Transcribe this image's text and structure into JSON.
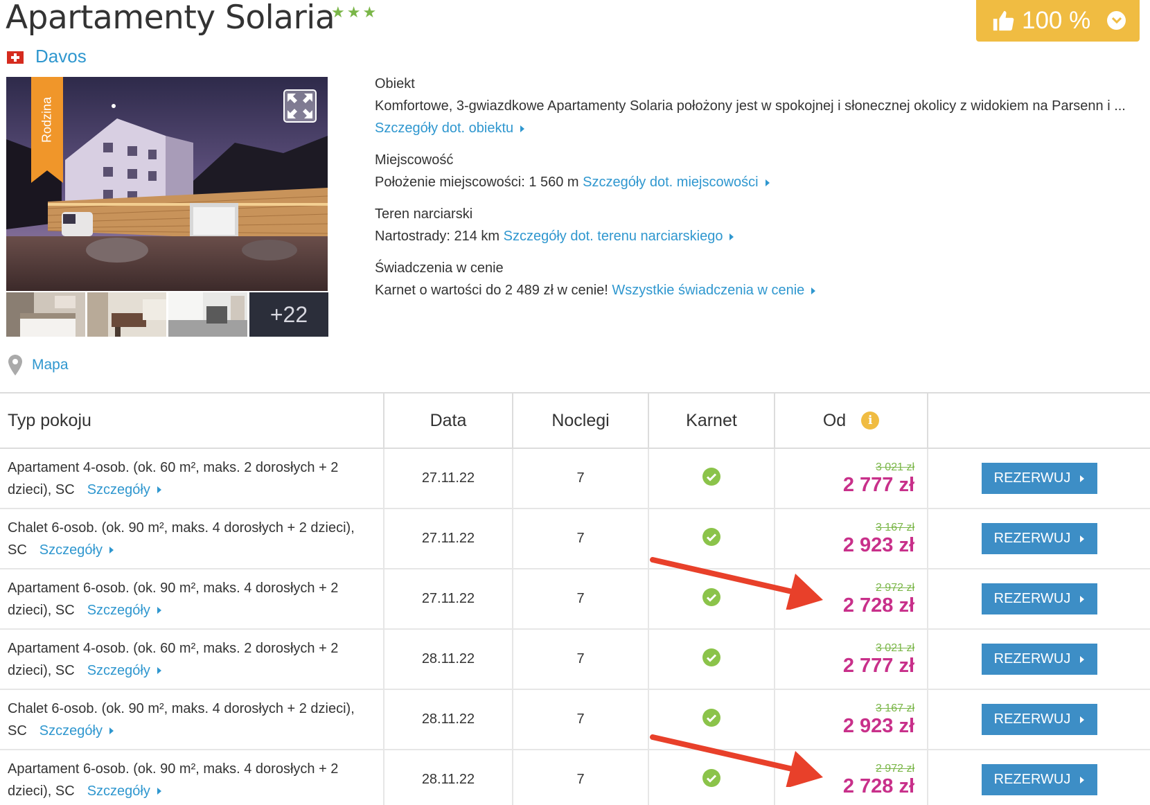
{
  "hotel": {
    "name": "Apartamenty Solaria",
    "stars": "★★★",
    "city": "Davos"
  },
  "rating": {
    "value": "100 %",
    "color": "#f0bc42"
  },
  "gallery": {
    "badge": "Rodzina",
    "more_label": "+22"
  },
  "map": {
    "label": "Mapa"
  },
  "info": {
    "object": {
      "heading": "Obiekt",
      "text": "Komfortowe, 3-gwiazdkowe Apartamenty Solaria położony jest w spokojnej i słonecznej okolicy z widokiem na Parsenn i ...",
      "link": "Szczegóły dot. obiektu"
    },
    "town": {
      "heading": "Miejscowość",
      "text": "Położenie miejscowości: 1 560 m",
      "link": "Szczegóły dot. miejscowości"
    },
    "ski": {
      "heading": "Teren narciarski",
      "text": "Nartostrady: 214 km",
      "link": "Szczegóły dot. terenu narciarskiego"
    },
    "benefits": {
      "heading": "Świadczenia w cenie",
      "text": "Karnet o wartości do 2 489 zł w cenie!",
      "link": "Wszystkie świadczenia w cenie"
    }
  },
  "table": {
    "headers": {
      "room": "Typ pokoju",
      "date": "Data",
      "nights": "Noclegi",
      "pass": "Karnet",
      "from": "Od"
    },
    "details_label": "Szczegóły",
    "book_label": "REZERWUJ",
    "rows": [
      {
        "room": "Apartament 4-osob. (ok. 60 m², maks. 2 dorosłych + 2 dzieci), SC",
        "date": "27.11.22",
        "nights": "7",
        "old_price": "3 021 zł",
        "price": "2 777 zł"
      },
      {
        "room": "Chalet 6-osob. (ok. 90 m², maks. 4 dorosłych + 2 dzieci), SC",
        "date": "27.11.22",
        "nights": "7",
        "old_price": "3 167 zł",
        "price": "2 923 zł"
      },
      {
        "room": "Apartament 6-osob. (ok. 90 m², maks. 4 dorosłych + 2 dzieci), SC",
        "date": "27.11.22",
        "nights": "7",
        "old_price": "2 972 zł",
        "price": "2 728 zł"
      },
      {
        "room": "Apartament 4-osob. (ok. 60 m², maks. 2 dorosłych + 2 dzieci), SC",
        "date": "28.11.22",
        "nights": "7",
        "old_price": "3 021 zł",
        "price": "2 777 zł"
      },
      {
        "room": "Chalet 6-osob. (ok. 90 m², maks. 4 dorosłych + 2 dzieci), SC",
        "date": "28.11.22",
        "nights": "7",
        "old_price": "3 167 zł",
        "price": "2 923 zł"
      },
      {
        "room": "Apartament 6-osob. (ok. 90 m², maks. 4 dorosłych + 2 dzieci), SC",
        "date": "28.11.22",
        "nights": "7",
        "old_price": "2 972 zł",
        "price": "2 728 zł"
      }
    ]
  },
  "colors": {
    "link": "#2f97cf",
    "price": "#c8308a",
    "old_price": "#7ab648",
    "button": "#3d8ec6",
    "annotation_arrow": "#e8402a"
  }
}
